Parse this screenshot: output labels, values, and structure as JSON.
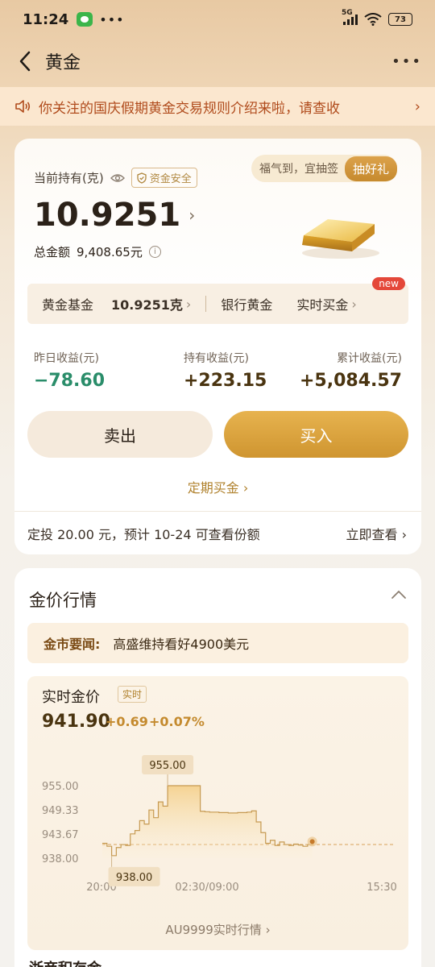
{
  "status_bar": {
    "time": "11:24",
    "network": "5G",
    "battery": "73"
  },
  "nav": {
    "title": "黄金"
  },
  "notice": {
    "text": "你关注的国庆假期黄金交易规则介绍来啦，请查收"
  },
  "holding": {
    "label": "当前持有(克)",
    "safe_badge": "资金安全",
    "amount": "10.9251",
    "total_label": "总金额",
    "total_value": "9,408.65元",
    "lottery_text": "福气到，宜抽签",
    "lottery_button": "抽好礼"
  },
  "fund_row": {
    "fund_label": "黄金基金",
    "fund_value": "10.9251克",
    "bank_gold": "银行黄金",
    "realtime_buy": "实时买金",
    "new_badge": "new"
  },
  "stats": [
    {
      "label": "昨日收益(元)",
      "value": "−78.60"
    },
    {
      "label": "持有收益(元)",
      "value": "+223.15"
    },
    {
      "label": "累计收益(元)",
      "value": "+5,084.57"
    }
  ],
  "actions": {
    "sell": "卖出",
    "buy": "买入",
    "regular_buy": "定期买金"
  },
  "plan": {
    "text": "定投 20.00 元，预计 10-24 可查看份额",
    "link": "立即查看"
  },
  "market": {
    "title": "金价行情",
    "news_label": "金市要闻:",
    "news_text": "高盛维持看好4900美元",
    "chart_title": "实时金价",
    "realtime_badge": "实时",
    "price": "941.90",
    "change": "+0.69",
    "change_pct": "+0.07%",
    "link": "AU9999实时行情"
  },
  "chart_data": {
    "type": "line",
    "y_ticks": [
      "955.00",
      "949.33",
      "943.67",
      "938.00"
    ],
    "ylim": [
      938.0,
      955.0
    ],
    "x_ticks": [
      "20:00",
      "02:30/09:00",
      "15:30"
    ],
    "max_label": "955.00",
    "min_label": "938.00",
    "reference_value": 941.21,
    "series": [
      {
        "values": [
          941.5,
          940.8,
          938.6,
          940.5,
          941.2,
          941.0,
          943.7,
          944.5,
          946.8,
          946.0,
          949.3,
          947.5,
          951.2,
          950.2,
          955.0,
          955.0,
          955.0,
          955.0,
          955.0,
          955.0,
          955.0,
          949.0,
          948.9,
          948.8,
          948.8,
          948.7,
          948.7,
          948.6,
          948.6,
          948.7,
          948.7,
          948.8,
          949.1,
          946.5,
          944.0,
          941.5,
          942.2,
          941.0,
          941.8,
          941.2,
          941.0,
          941.3,
          941.1,
          940.8,
          941.2,
          941.9
        ]
      }
    ]
  },
  "bottom": {
    "peek_text": "浙商积存金"
  }
}
